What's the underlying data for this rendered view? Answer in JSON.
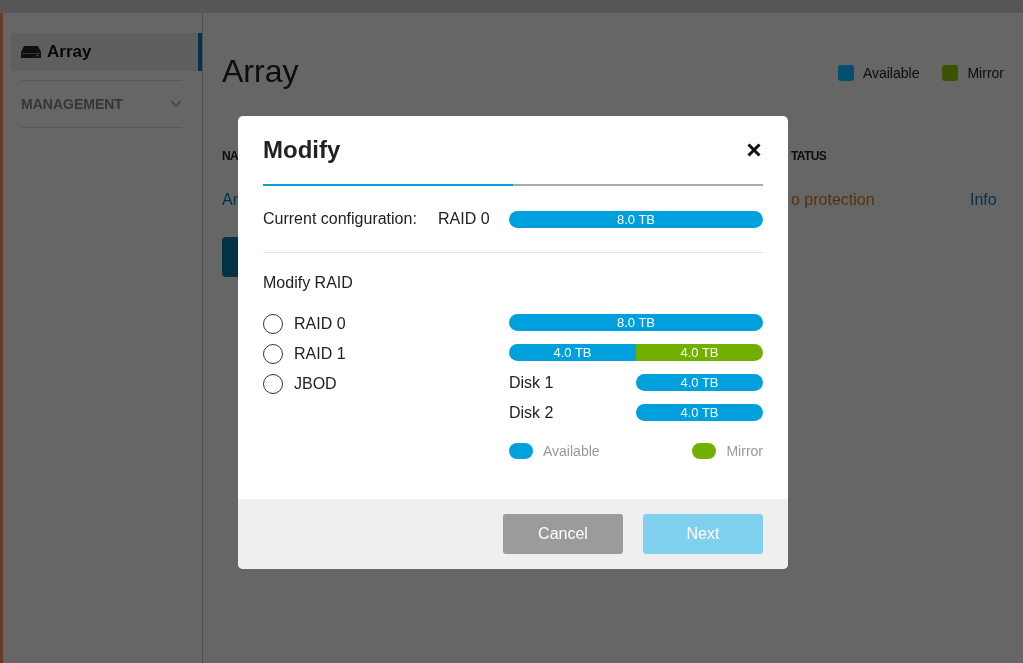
{
  "sidebar": {
    "items": [
      {
        "label": "Array",
        "selected": true
      }
    ],
    "sections": [
      {
        "label": "MANAGEMENT",
        "expanded": false
      }
    ]
  },
  "page": {
    "title": "Array",
    "legend": [
      {
        "label": "Available",
        "color": "#00506e"
      },
      {
        "label": "Mirror",
        "color": "#3a5400"
      }
    ],
    "table": {
      "columns": [
        "NA",
        "TATUS"
      ],
      "rows": [
        {
          "cells": [
            {
              "text": "Ar",
              "kind": "link"
            },
            {
              "text": "o protection",
              "kind": "warning"
            },
            {
              "text": "Info",
              "kind": "link"
            }
          ]
        }
      ]
    },
    "action_button": {
      "kind": "primary"
    }
  },
  "dialog": {
    "title": "Modify",
    "progress": {
      "level": 0.5
    },
    "current": {
      "label": "Current configuration:",
      "value": "RAID 0",
      "segments": [
        {
          "label": "8.0 TB",
          "kind": "available"
        }
      ]
    },
    "section_title": "Modify RAID",
    "options": [
      {
        "label": "RAID 0",
        "selected": false
      },
      {
        "label": "RAID 1",
        "selected": false
      },
      {
        "label": "JBOD",
        "selected": false
      }
    ],
    "preview": [
      {
        "segments": [
          {
            "label": "8.0 TB",
            "kind": "available"
          }
        ]
      },
      {
        "segments": [
          {
            "label": "4.0 TB",
            "kind": "available"
          },
          {
            "label": "4.0 TB",
            "kind": "mirror"
          }
        ]
      },
      {
        "label": "Disk 1",
        "segments": [
          {
            "label": "4.0 TB",
            "kind": "available"
          }
        ]
      },
      {
        "label": "Disk 2",
        "segments": [
          {
            "label": "4.0 TB",
            "kind": "available"
          }
        ]
      }
    ],
    "legend": [
      {
        "label": "Available",
        "color": "#00a0dc"
      },
      {
        "label": "Mirror",
        "color": "#72b000"
      }
    ],
    "buttons": [
      {
        "label": "Cancel",
        "kind": "secondary",
        "disabled": false
      },
      {
        "label": "Next",
        "kind": "primary",
        "disabled": true
      }
    ]
  }
}
